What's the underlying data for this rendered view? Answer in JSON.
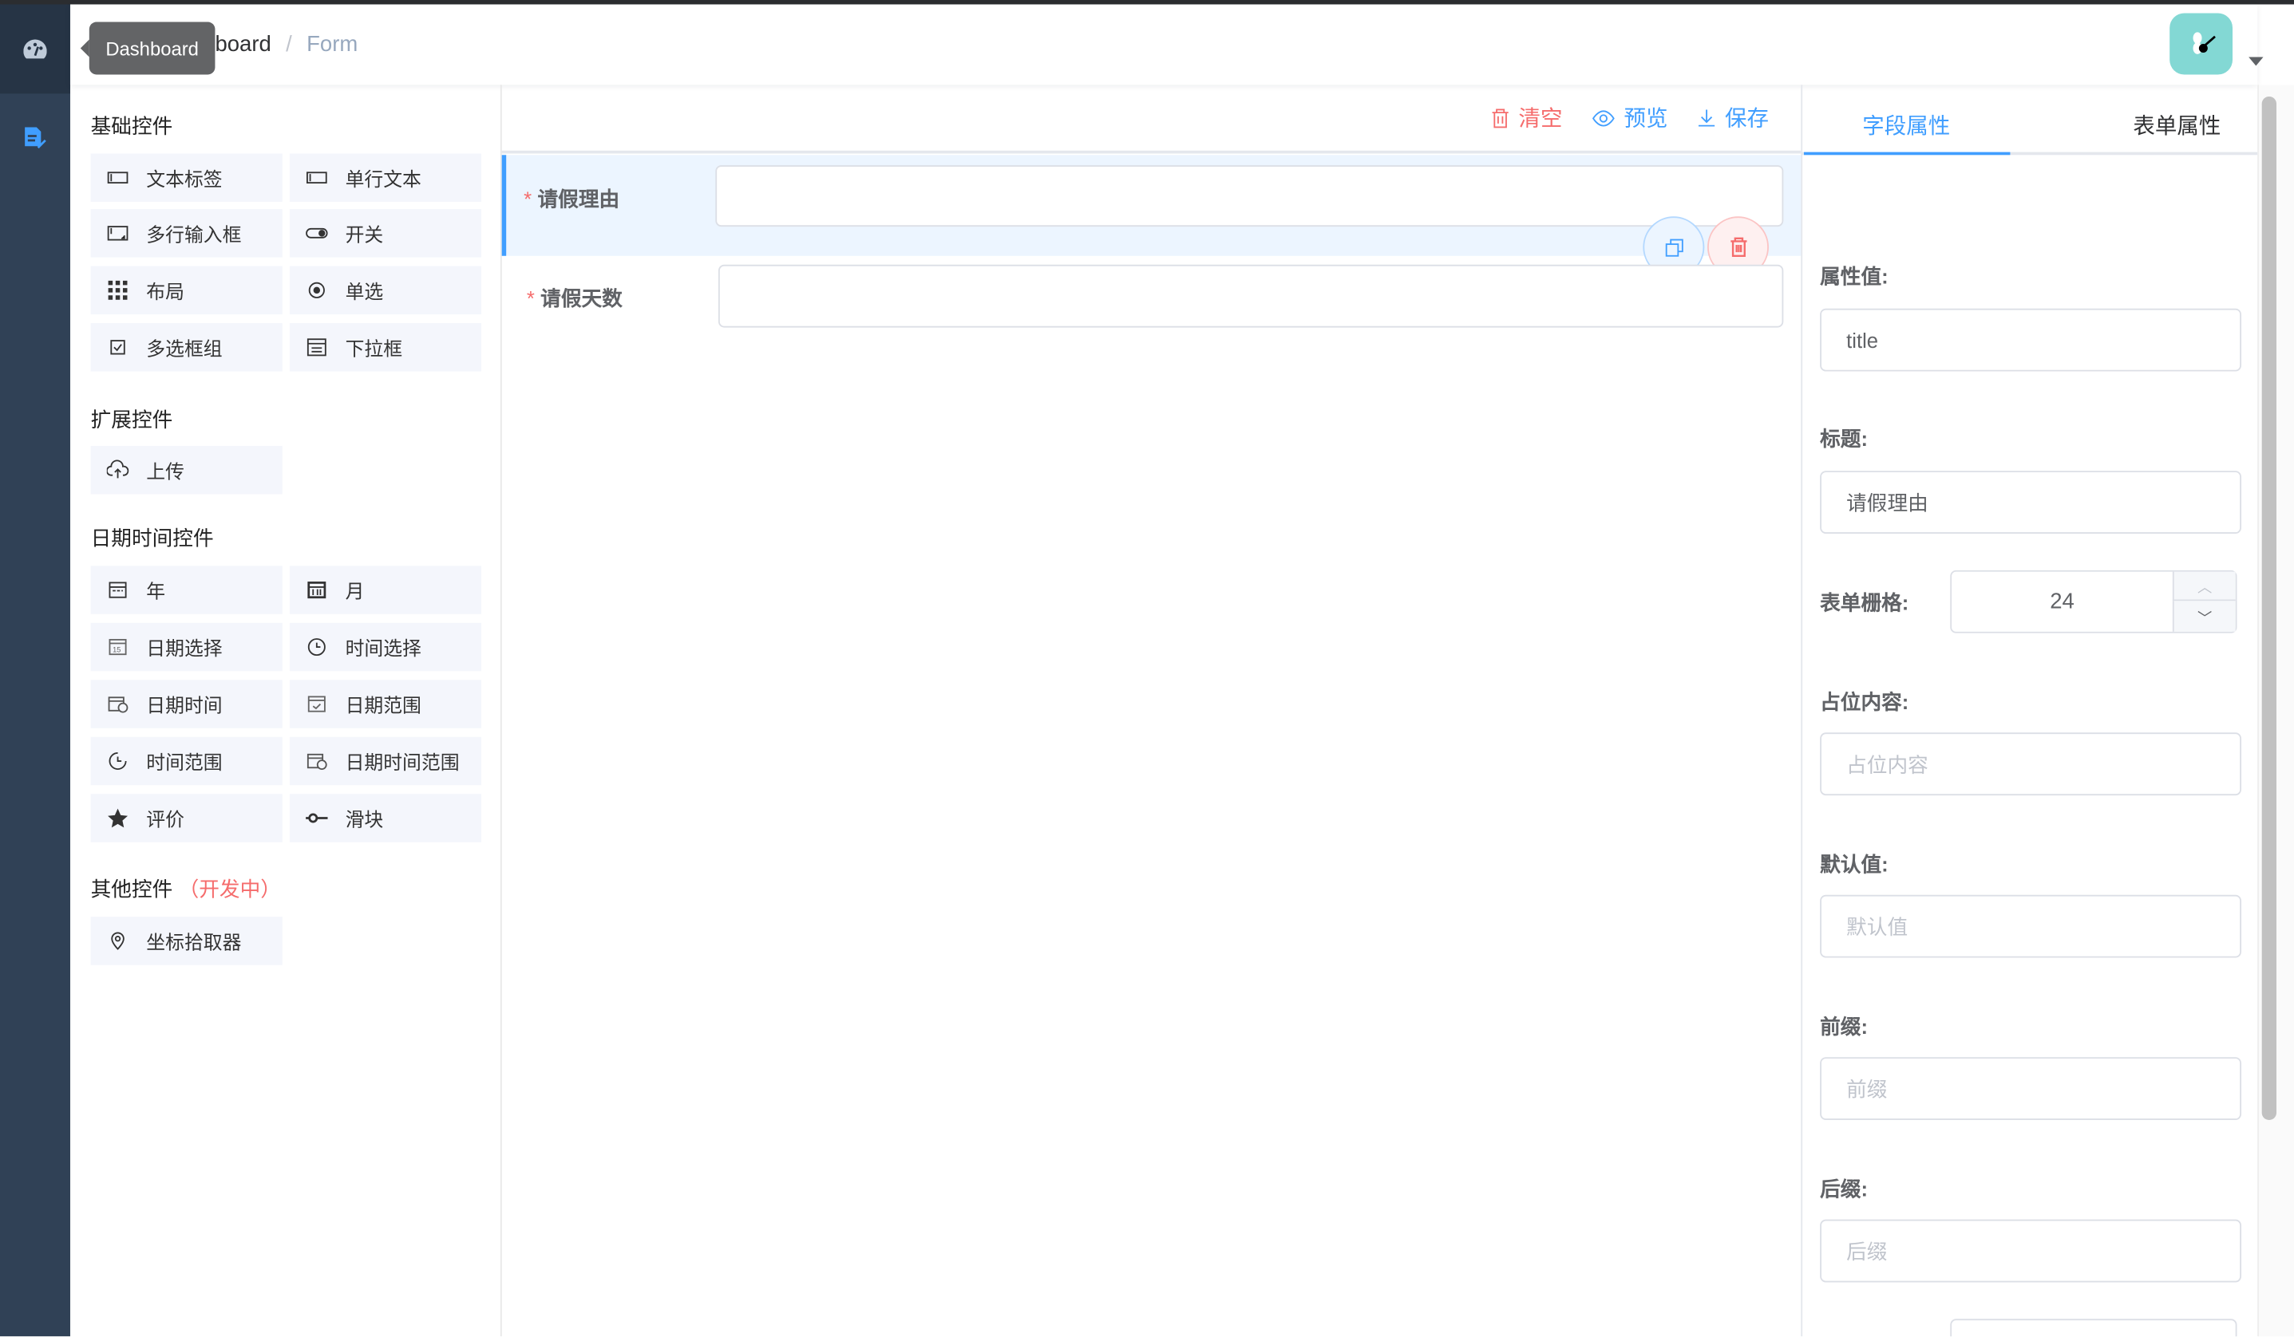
{
  "header": {
    "breadcrumb": [
      "Dashboard",
      "Form"
    ],
    "tooltip": "Dashboard"
  },
  "left": {
    "sections": [
      {
        "title": "基础控件",
        "items": [
          {
            "label": "文本标签",
            "icon": "text-label-icon"
          },
          {
            "label": "单行文本",
            "icon": "input-icon"
          },
          {
            "label": "多行输入框",
            "icon": "textarea-icon"
          },
          {
            "label": "开关",
            "icon": "switch-icon"
          },
          {
            "label": "布局",
            "icon": "grid-icon"
          },
          {
            "label": "单选",
            "icon": "radio-icon"
          },
          {
            "label": "多选框组",
            "icon": "checkbox-icon"
          },
          {
            "label": "下拉框",
            "icon": "select-icon"
          }
        ]
      },
      {
        "title": "扩展控件",
        "items": [
          {
            "label": "上传",
            "icon": "upload-icon"
          }
        ]
      },
      {
        "title": "日期时间控件",
        "items": [
          {
            "label": "年",
            "icon": "calendar-icon"
          },
          {
            "label": "月",
            "icon": "calendar-icon"
          },
          {
            "label": "日期选择",
            "icon": "date-icon"
          },
          {
            "label": "时间选择",
            "icon": "clock-icon"
          },
          {
            "label": "日期时间",
            "icon": "datetime-icon"
          },
          {
            "label": "日期范围",
            "icon": "date-range-icon"
          },
          {
            "label": "时间范围",
            "icon": "time-range-icon"
          },
          {
            "label": "日期时间范围",
            "icon": "datetime-range-icon"
          },
          {
            "label": "评价",
            "icon": "star-icon"
          },
          {
            "label": "滑块",
            "icon": "slider-icon"
          }
        ]
      },
      {
        "title": "其他控件",
        "badge": "（开发中）",
        "items": [
          {
            "label": "坐标拾取器",
            "icon": "location-icon"
          }
        ]
      }
    ]
  },
  "toolbar": {
    "clear": "清空",
    "preview": "预览",
    "save": "保存"
  },
  "form": {
    "fields": [
      {
        "label": "请假理由",
        "required": "*"
      },
      {
        "label": "请假天数",
        "required": "*"
      }
    ]
  },
  "right": {
    "tabs": [
      "字段属性",
      "表单属性"
    ],
    "props": [
      {
        "label": "属性值:",
        "value": "title"
      },
      {
        "label": "标题:",
        "value": "请假理由"
      },
      {
        "label": "表单栅格:",
        "value": "24"
      },
      {
        "label": "占位内容:",
        "placeholder": "占位内容"
      },
      {
        "label": "默认值:",
        "placeholder": "默认值"
      },
      {
        "label": "前缀:",
        "placeholder": "前缀"
      },
      {
        "label": "后缀:",
        "placeholder": "后缀"
      }
    ]
  },
  "colors": {
    "accent": "#409eff",
    "danger": "#f56c6c",
    "sidebar": "#304156"
  }
}
